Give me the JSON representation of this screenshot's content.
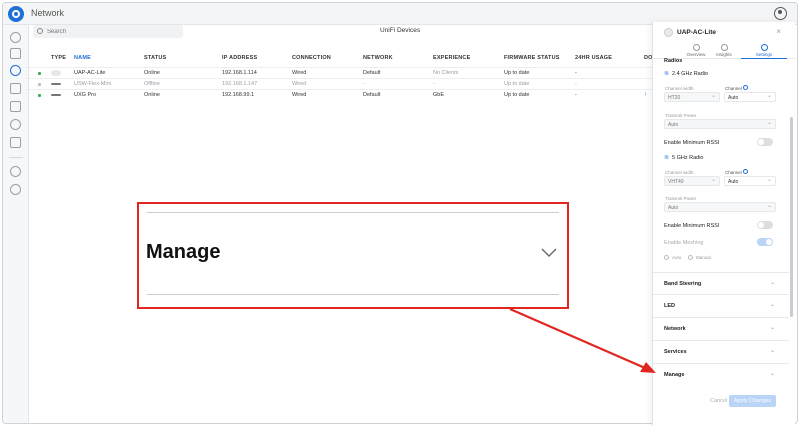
{
  "app": {
    "title": "Network"
  },
  "search": {
    "placeholder": "Search"
  },
  "page": {
    "title": "UniFi Devices"
  },
  "table": {
    "columns": [
      "TYPE",
      "NAME",
      "STATUS",
      "IP ADDRESS",
      "CONNECTION",
      "NETWORK",
      "EXPERIENCE",
      "FIRMWARE STATUS",
      "24HR USAGE",
      "DO"
    ],
    "sorted_column": "NAME",
    "rows": [
      {
        "name": "UAP-AC-Lite",
        "status": "Online",
        "ip": "192.168.1.114",
        "connection": "Wired",
        "network": "Default",
        "experience": "No Clients",
        "firmware": "Up to date",
        "usage": "-",
        "status_color": "#3aa757"
      },
      {
        "name": "USW-Flex-Mini",
        "status": "Offline",
        "ip": "192.168.1.147",
        "connection": "Wired",
        "network": "-",
        "experience": "-",
        "firmware": "Up to date",
        "usage": "-",
        "status_color": "#b6bbc0"
      },
      {
        "name": "UXG Pro",
        "status": "Online",
        "ip": "192.168.99.1",
        "connection": "Wired",
        "network": "Default",
        "experience": "GbE",
        "firmware": "Up to date",
        "usage": "-",
        "status_color": "#3aa757"
      }
    ]
  },
  "panel": {
    "device_name": "UAP-AC-Lite",
    "close": "×",
    "tabs": [
      {
        "label": "Overview",
        "active": false
      },
      {
        "label": "Insights",
        "active": false
      },
      {
        "label": "Settings",
        "active": true
      }
    ],
    "radios_header": "Radios",
    "radio_24": {
      "title": "2.4 GHz Radio",
      "channel_width_label": "Channel width",
      "channel_width": "HT20",
      "channel_label": "Channel",
      "channel": "Auto",
      "transmit_power_label": "Transmit Power",
      "transmit_power": "Auto",
      "min_rssi_label": "Enable Minimum RSSI"
    },
    "radio_5": {
      "title": "5 GHz Radio",
      "channel_width_label": "Channel width",
      "channel_width": "VHT40",
      "channel_label": "Channel",
      "channel": "Auto",
      "transmit_power_label": "Transmit Power",
      "transmit_power": "Auto",
      "min_rssi_label": "Enable Minimum RSSI",
      "meshing_label": "Enable Meshing",
      "auto_label": "Auto",
      "manual_label": "Manual"
    },
    "sections": [
      "Band Steering",
      "LED",
      "Network",
      "Services",
      "Manage"
    ],
    "cancel_label": "Cancel",
    "apply_label": "Apply Changes"
  },
  "callout": {
    "label": "Manage",
    "border_color": "#e3251f"
  }
}
